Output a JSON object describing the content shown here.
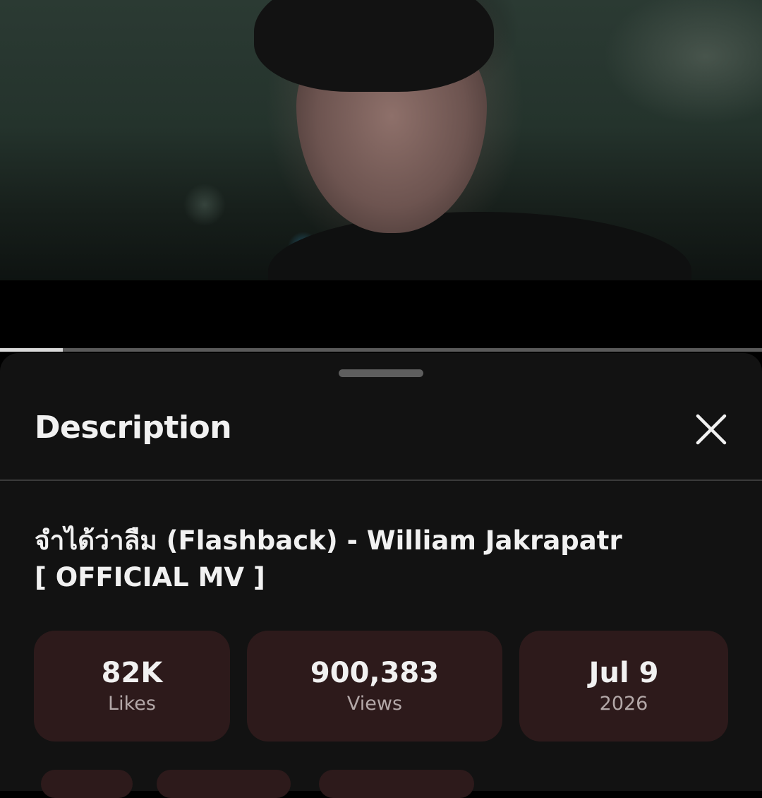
{
  "player": {
    "progress_fraction": 0.082
  },
  "sheet": {
    "title": "Description",
    "close_icon": "close-icon"
  },
  "video": {
    "title_line1": "จำได้ว่าลืม (Flashback) - William Jakrapatr",
    "title_line2": "[ OFFICIAL MV ]"
  },
  "stats": [
    {
      "value": "82K",
      "label": "Likes"
    },
    {
      "value": "900,383",
      "label": "Views"
    },
    {
      "value": "Jul 9",
      "label": "2026"
    }
  ],
  "colors": {
    "sheet_background": "#121212",
    "stat_background": "#2d1a1b",
    "text_primary": "#f1f1f1",
    "text_secondary": "#b3a8a8"
  }
}
